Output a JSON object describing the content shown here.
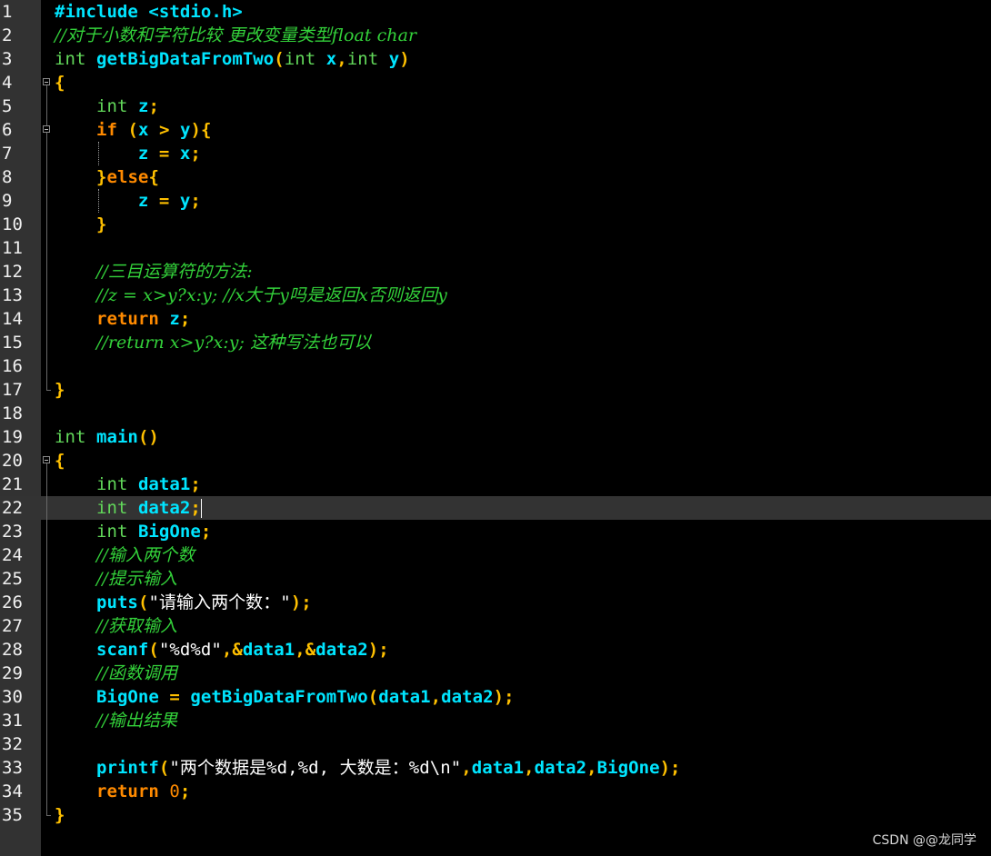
{
  "editor": {
    "current_line": 22,
    "watermark": "CSDN @@龙同学",
    "colors": {
      "background": "#000000",
      "gutter": "#323232",
      "current_line": "#333333",
      "preprocessor": "#00e5ff",
      "comment": "#33d13a",
      "type": "#62d85a",
      "keyword": "#ff8a00",
      "identifier": "#00e5ff",
      "operator": "#ffc000",
      "string": "#ffffff"
    },
    "fold_markers": [
      {
        "line": 4,
        "kind": "open"
      },
      {
        "line": 6,
        "kind": "open"
      },
      {
        "line": 17,
        "kind": "close"
      },
      {
        "line": 20,
        "kind": "open"
      },
      {
        "line": 35,
        "kind": "close"
      }
    ],
    "lines": [
      {
        "n": "1",
        "tokens": [
          [
            "pre",
            "#include <stdio.h>"
          ]
        ]
      },
      {
        "n": "2",
        "tokens": [
          [
            "cm",
            "//对于小数和字符比较 更改变量类型float char"
          ]
        ]
      },
      {
        "n": "3",
        "tokens": [
          [
            "type",
            "int"
          ],
          [
            "ws",
            " "
          ],
          [
            "id",
            "getBigDataFromTwo"
          ],
          [
            "op",
            "("
          ],
          [
            "type",
            "int"
          ],
          [
            "ws",
            " "
          ],
          [
            "id",
            "x"
          ],
          [
            "op",
            ","
          ],
          [
            "type",
            "int"
          ],
          [
            "ws",
            " "
          ],
          [
            "id",
            "y"
          ],
          [
            "op",
            ")"
          ]
        ]
      },
      {
        "n": "4",
        "tokens": [
          [
            "op",
            "{"
          ]
        ]
      },
      {
        "n": "5",
        "tokens": [
          [
            "ws",
            "    "
          ],
          [
            "type",
            "int"
          ],
          [
            "ws",
            " "
          ],
          [
            "id",
            "z"
          ],
          [
            "op",
            ";"
          ]
        ]
      },
      {
        "n": "6",
        "tokens": [
          [
            "ws",
            "    "
          ],
          [
            "kw",
            "if"
          ],
          [
            "ws",
            " "
          ],
          [
            "op",
            "("
          ],
          [
            "id",
            "x"
          ],
          [
            "ws",
            " "
          ],
          [
            "op",
            ">"
          ],
          [
            "ws",
            " "
          ],
          [
            "id",
            "y"
          ],
          [
            "op",
            "){"
          ]
        ]
      },
      {
        "n": "7",
        "tokens": [
          [
            "ws",
            "        "
          ],
          [
            "id",
            "z"
          ],
          [
            "ws",
            " "
          ],
          [
            "op",
            "="
          ],
          [
            "ws",
            " "
          ],
          [
            "id",
            "x"
          ],
          [
            "op",
            ";"
          ]
        ]
      },
      {
        "n": "8",
        "tokens": [
          [
            "ws",
            "    "
          ],
          [
            "op",
            "}"
          ],
          [
            "kw",
            "else"
          ],
          [
            "op",
            "{"
          ]
        ]
      },
      {
        "n": "9",
        "tokens": [
          [
            "ws",
            "        "
          ],
          [
            "id",
            "z"
          ],
          [
            "ws",
            " "
          ],
          [
            "op",
            "="
          ],
          [
            "ws",
            " "
          ],
          [
            "id",
            "y"
          ],
          [
            "op",
            ";"
          ]
        ]
      },
      {
        "n": "10",
        "tokens": [
          [
            "ws",
            "    "
          ],
          [
            "op",
            "}"
          ]
        ]
      },
      {
        "n": "11",
        "tokens": []
      },
      {
        "n": "12",
        "tokens": [
          [
            "ws",
            "    "
          ],
          [
            "cm",
            "//三目运算符的方法:"
          ]
        ]
      },
      {
        "n": "13",
        "tokens": [
          [
            "ws",
            "    "
          ],
          [
            "cm",
            "//z = x>y?x:y; //x大于y吗是返回x否则返回y"
          ]
        ]
      },
      {
        "n": "14",
        "tokens": [
          [
            "ws",
            "    "
          ],
          [
            "kw",
            "return"
          ],
          [
            "ws",
            " "
          ],
          [
            "id",
            "z"
          ],
          [
            "op",
            ";"
          ]
        ]
      },
      {
        "n": "15",
        "tokens": [
          [
            "ws",
            "    "
          ],
          [
            "cm",
            "//return x>y?x:y; 这种写法也可以"
          ]
        ]
      },
      {
        "n": "16",
        "tokens": []
      },
      {
        "n": "17",
        "tokens": [
          [
            "op",
            "}"
          ]
        ]
      },
      {
        "n": "18",
        "tokens": []
      },
      {
        "n": "19",
        "tokens": [
          [
            "type",
            "int"
          ],
          [
            "ws",
            " "
          ],
          [
            "id",
            "main"
          ],
          [
            "op",
            "()"
          ]
        ]
      },
      {
        "n": "20",
        "tokens": [
          [
            "op",
            "{"
          ]
        ]
      },
      {
        "n": "21",
        "tokens": [
          [
            "ws",
            "    "
          ],
          [
            "type",
            "int"
          ],
          [
            "ws",
            " "
          ],
          [
            "id",
            "data1"
          ],
          [
            "op",
            ";"
          ]
        ]
      },
      {
        "n": "22",
        "tokens": [
          [
            "ws",
            "    "
          ],
          [
            "type",
            "int"
          ],
          [
            "ws",
            " "
          ],
          [
            "id",
            "data2"
          ],
          [
            "op",
            ";"
          ]
        ]
      },
      {
        "n": "23",
        "tokens": [
          [
            "ws",
            "    "
          ],
          [
            "type",
            "int"
          ],
          [
            "ws",
            " "
          ],
          [
            "id",
            "BigOne"
          ],
          [
            "op",
            ";"
          ]
        ]
      },
      {
        "n": "24",
        "tokens": [
          [
            "ws",
            "    "
          ],
          [
            "cm",
            "//输入两个数"
          ]
        ]
      },
      {
        "n": "25",
        "tokens": [
          [
            "ws",
            "    "
          ],
          [
            "cm",
            "//提示输入"
          ]
        ]
      },
      {
        "n": "26",
        "tokens": [
          [
            "ws",
            "    "
          ],
          [
            "id",
            "puts"
          ],
          [
            "op",
            "("
          ],
          [
            "str",
            "\"请输入两个数：\""
          ],
          [
            "op",
            ");"
          ]
        ]
      },
      {
        "n": "27",
        "tokens": [
          [
            "ws",
            "    "
          ],
          [
            "cm",
            "//获取输入"
          ]
        ]
      },
      {
        "n": "28",
        "tokens": [
          [
            "ws",
            "    "
          ],
          [
            "id",
            "scanf"
          ],
          [
            "op",
            "("
          ],
          [
            "str",
            "\"%d%d\""
          ],
          [
            "op",
            ",&"
          ],
          [
            "id",
            "data1"
          ],
          [
            "op",
            ",&"
          ],
          [
            "id",
            "data2"
          ],
          [
            "op",
            ");"
          ]
        ]
      },
      {
        "n": "29",
        "tokens": [
          [
            "ws",
            "    "
          ],
          [
            "cm",
            "//函数调用"
          ]
        ]
      },
      {
        "n": "30",
        "tokens": [
          [
            "ws",
            "    "
          ],
          [
            "id",
            "BigOne"
          ],
          [
            "ws",
            " "
          ],
          [
            "op",
            "="
          ],
          [
            "ws",
            " "
          ],
          [
            "id",
            "getBigDataFromTwo"
          ],
          [
            "op",
            "("
          ],
          [
            "id",
            "data1"
          ],
          [
            "op",
            ","
          ],
          [
            "id",
            "data2"
          ],
          [
            "op",
            ");"
          ]
        ]
      },
      {
        "n": "31",
        "tokens": [
          [
            "ws",
            "    "
          ],
          [
            "cm",
            "//输出结果"
          ]
        ]
      },
      {
        "n": "32",
        "tokens": []
      },
      {
        "n": "33",
        "tokens": [
          [
            "ws",
            "    "
          ],
          [
            "id",
            "printf"
          ],
          [
            "op",
            "("
          ],
          [
            "str",
            "\"两个数据是%d,%d, 大数是：%d\\n\""
          ],
          [
            "op",
            ","
          ],
          [
            "id",
            "data1"
          ],
          [
            "op",
            ","
          ],
          [
            "id",
            "data2"
          ],
          [
            "op",
            ","
          ],
          [
            "id",
            "BigOne"
          ],
          [
            "op",
            ");"
          ]
        ]
      },
      {
        "n": "34",
        "tokens": [
          [
            "ws",
            "    "
          ],
          [
            "kw",
            "return"
          ],
          [
            "ws",
            " "
          ],
          [
            "num",
            "0"
          ],
          [
            "op",
            ";"
          ]
        ]
      },
      {
        "n": "35",
        "tokens": [
          [
            "op",
            "}"
          ]
        ]
      }
    ]
  }
}
